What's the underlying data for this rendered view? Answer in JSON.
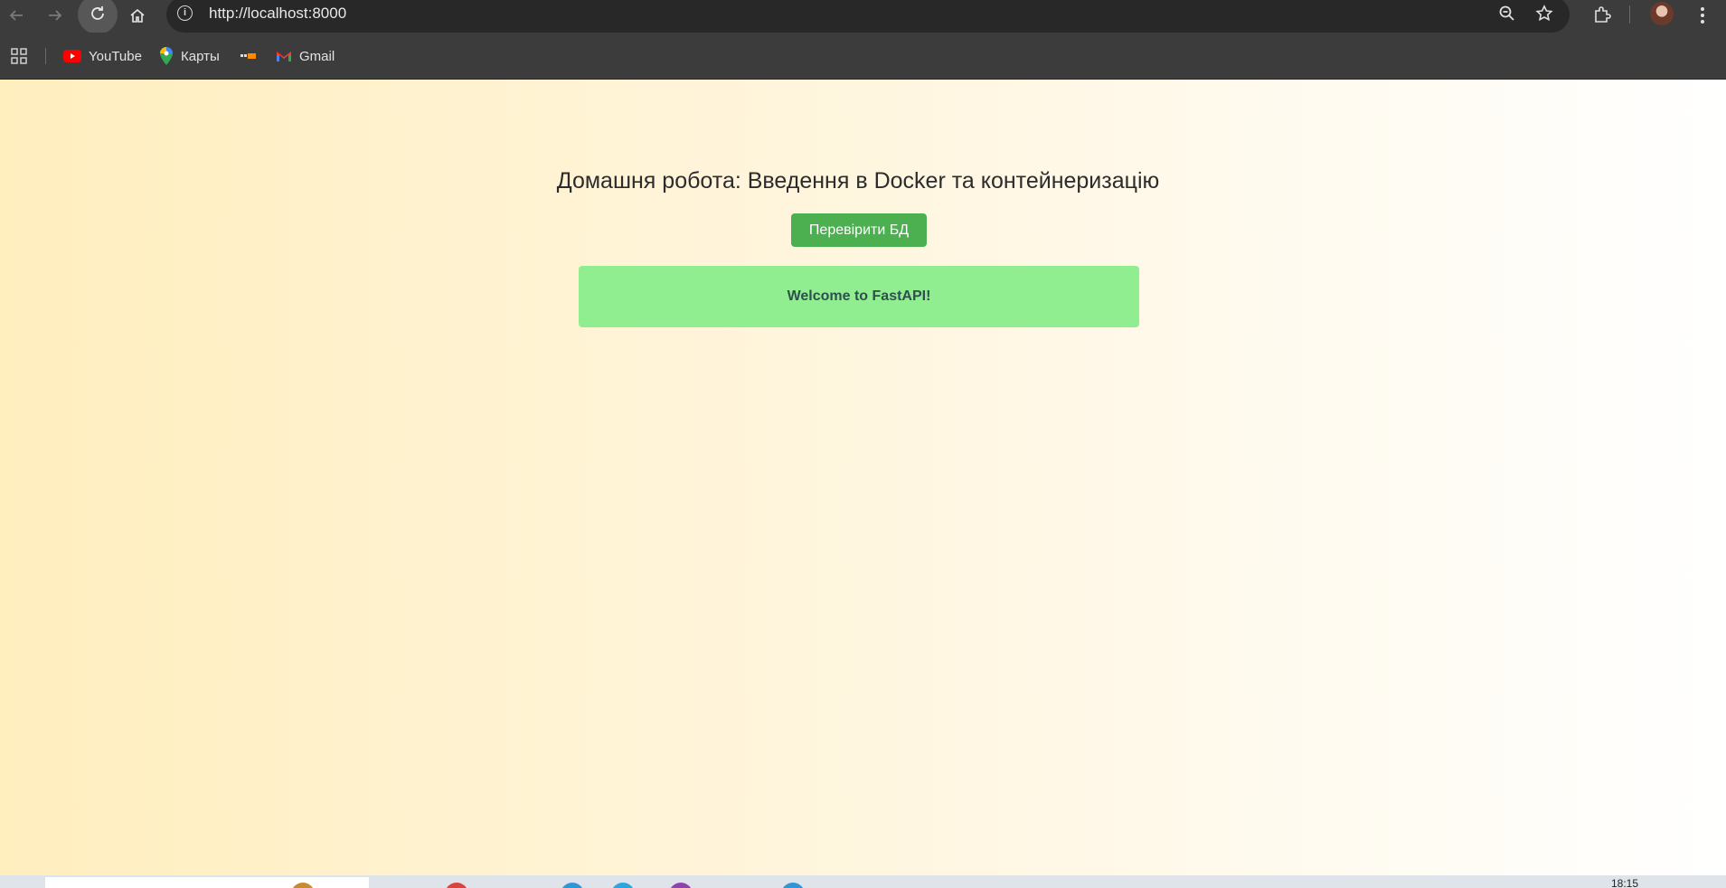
{
  "browser": {
    "url": "http://localhost:8000",
    "back_icon": "arrow-left-icon",
    "forward_icon": "arrow-right-icon",
    "reload_icon": "reload-icon",
    "home_icon": "home-icon",
    "site_info_icon": "info-icon",
    "zoom_icon": "zoom-icon",
    "bookmark_icon": "star-icon",
    "extensions_icon": "puzzle-icon",
    "menu_icon": "kebab-menu-icon"
  },
  "bookmarks": {
    "apps_icon": "apps-grid-icon",
    "items": [
      {
        "label": "YouTube",
        "icon": "youtube-icon"
      },
      {
        "label": "Карты",
        "icon": "maps-pin-icon"
      },
      {
        "label": "",
        "icon": "bookmark-favicon-icon"
      },
      {
        "label": "Gmail",
        "icon": "gmail-icon"
      }
    ]
  },
  "page": {
    "heading": "Домашня робота: Введення в Docker та контейнеризацію",
    "check_button": "Перевірити БД",
    "message": "Welcome to FastAPI!"
  },
  "taskbar": {
    "time": "18:15"
  },
  "colors": {
    "button_green": "#4caf50",
    "message_bg": "#90ee90",
    "chrome_dark": "#3c3c3c"
  }
}
